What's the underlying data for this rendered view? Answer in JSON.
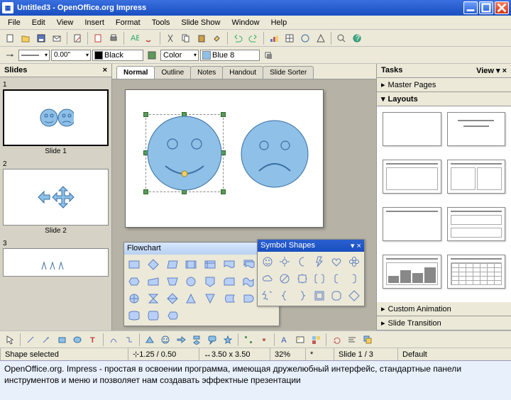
{
  "titlebar": {
    "title": "Untitled3 - OpenOffice.org Impress"
  },
  "menu": [
    "File",
    "Edit",
    "View",
    "Insert",
    "Format",
    "Tools",
    "Slide Show",
    "Window",
    "Help"
  ],
  "toolbar2": {
    "line_color_label": "Black",
    "fill_type": "Color",
    "fill_color": "Blue 8"
  },
  "slides_panel": {
    "title": "Slides",
    "items": [
      {
        "num": "1",
        "label": "Slide 1"
      },
      {
        "num": "2",
        "label": "Slide 2"
      },
      {
        "num": "3",
        "label": ""
      }
    ]
  },
  "viewtabs": [
    "Normal",
    "Outline",
    "Notes",
    "Handout",
    "Slide Sorter"
  ],
  "active_tab": 0,
  "flowchart": {
    "title": "Flowchart"
  },
  "symbol": {
    "title": "Symbol Shapes"
  },
  "tasks": {
    "title": "Tasks",
    "view_label": "View",
    "sections": [
      "Master Pages",
      "Layouts",
      "Custom Animation",
      "Slide Transition"
    ],
    "expanded": 1
  },
  "status": {
    "msg": "Shape selected",
    "pos": "1.25 / 0.50",
    "size": "3.50 x 3.50",
    "zoom": "32%",
    "slide": "Slide 1 / 3",
    "layout": "Default"
  },
  "caption": "OpenOffice.org. Impress - простая в освоении программа, имеющая дружелюбный интерфейс, стандартные панели инструментов и меню и позволяет нам создавать эффектные презентации"
}
